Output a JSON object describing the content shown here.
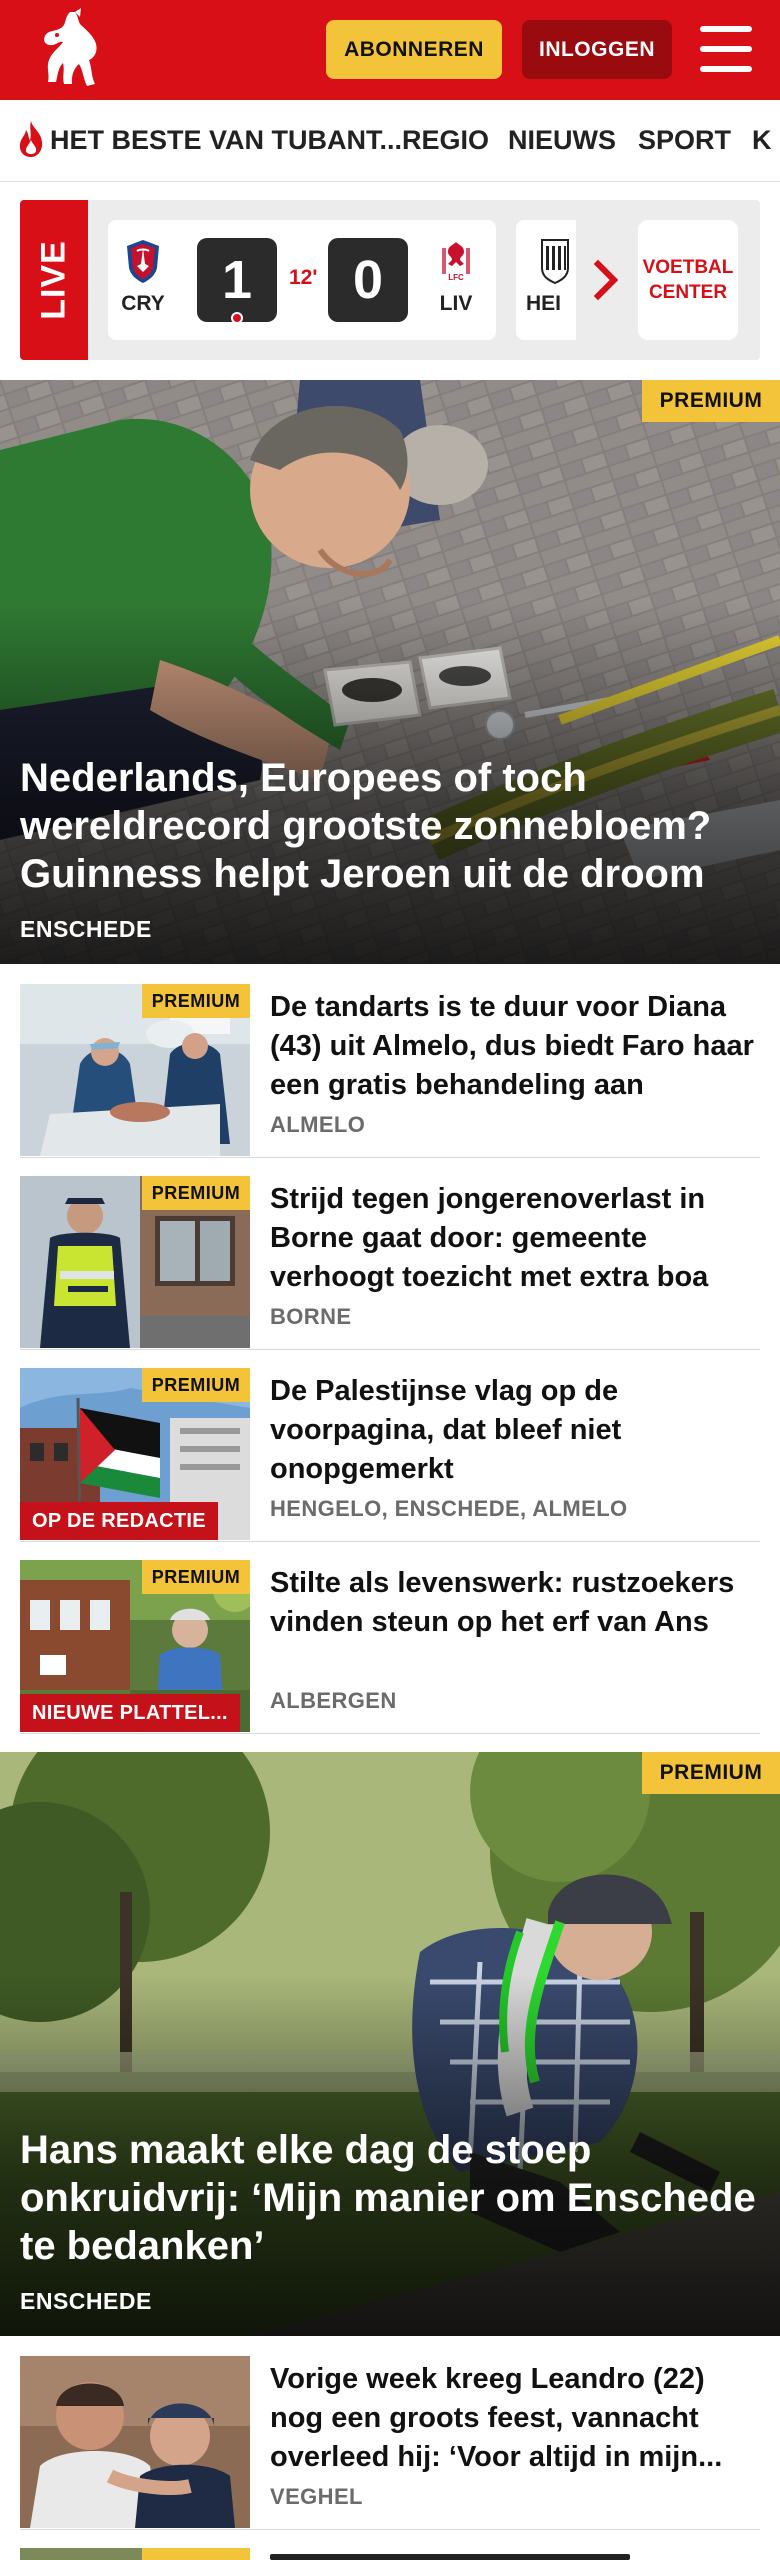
{
  "header": {
    "subscribe_label": "ABONNEREN",
    "login_label": "INLOGGEN"
  },
  "nav": {
    "items": [
      "HET BESTE VAN TUBANT...",
      "REGIO",
      "NIEUWS",
      "SPORT",
      "K"
    ]
  },
  "live": {
    "tag": "LIVE",
    "match": {
      "home_code": "CRY",
      "away_code": "LIV",
      "home_score": "1",
      "away_score": "0",
      "minute": "12'"
    },
    "next_match_code": "HEI",
    "voetbal_center_line1": "VOETBAL",
    "voetbal_center_line2": "CENTER"
  },
  "hero1": {
    "badge": "PREMIUM",
    "title": "Nederlands, Europees of toch wereldrecord grootste zonnebloem? Guinness helpt Jeroen uit de droom",
    "place": "ENSCHEDE"
  },
  "articles": [
    {
      "badge": "PREMIUM",
      "label": "",
      "title": "De tandarts is te duur voor Diana (43) uit Almelo, dus biedt Faro haar een gratis behandeling aan",
      "place": "ALMELO"
    },
    {
      "badge": "PREMIUM",
      "label": "",
      "title": "Strijd tegen jongerenoverlast in Borne gaat door: gemeente verhoogt toezicht met extra boa",
      "place": "BORNE"
    },
    {
      "badge": "PREMIUM",
      "label": "OP DE REDACTIE",
      "title": "De Palestijnse vlag op de voorpagina, dat bleef niet onopgemerkt",
      "place": "HENGELO, ENSCHEDE, ALMELO"
    },
    {
      "badge": "PREMIUM",
      "label": "NIEUWE PLATTEL...",
      "title": "Stilte als levenswerk: rustzoe­kers vinden steun op het erf van Ans",
      "place": "ALBERGEN"
    }
  ],
  "hero2": {
    "badge": "PREMIUM",
    "title": "Hans maakt elke dag de stoep onkruidvrij: ‘Mijn manier om Enschede te bedanken’",
    "place": "ENSCHEDE"
  },
  "article_last": {
    "badge": "",
    "title": "Vorige week kreeg Leandro (22) nog een groots feest, vannacht overleed hij: ‘Voor altijd in mijn...",
    "place": "VEGHEL"
  },
  "article_peek": {
    "badge": "PREMIUM"
  },
  "colors": {
    "brand_red": "#d80f16",
    "premium_yellow": "#f3c339",
    "login_dark_red": "#9a0b10"
  }
}
